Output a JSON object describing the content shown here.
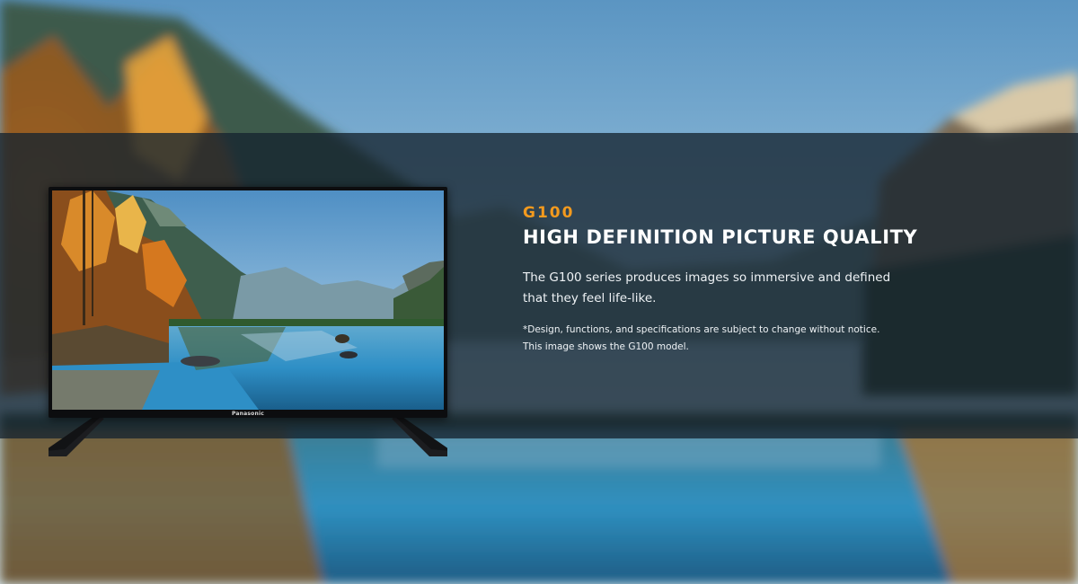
{
  "banner": {
    "model": "G100",
    "headline": "HIGH DEFINITION PICTURE QUALITY",
    "description": "The G100 series produces images so immersive and defined that they feel life-like.",
    "disclaimer_line1": "*Design, functions, and specifications are subject to change without notice.",
    "disclaimer_line2": "This image shows the G100 model."
  },
  "tv": {
    "brand_logo": "Panasonic"
  },
  "colors": {
    "accent": "#f39a1e",
    "band": "#162430",
    "text": "#ffffff"
  }
}
